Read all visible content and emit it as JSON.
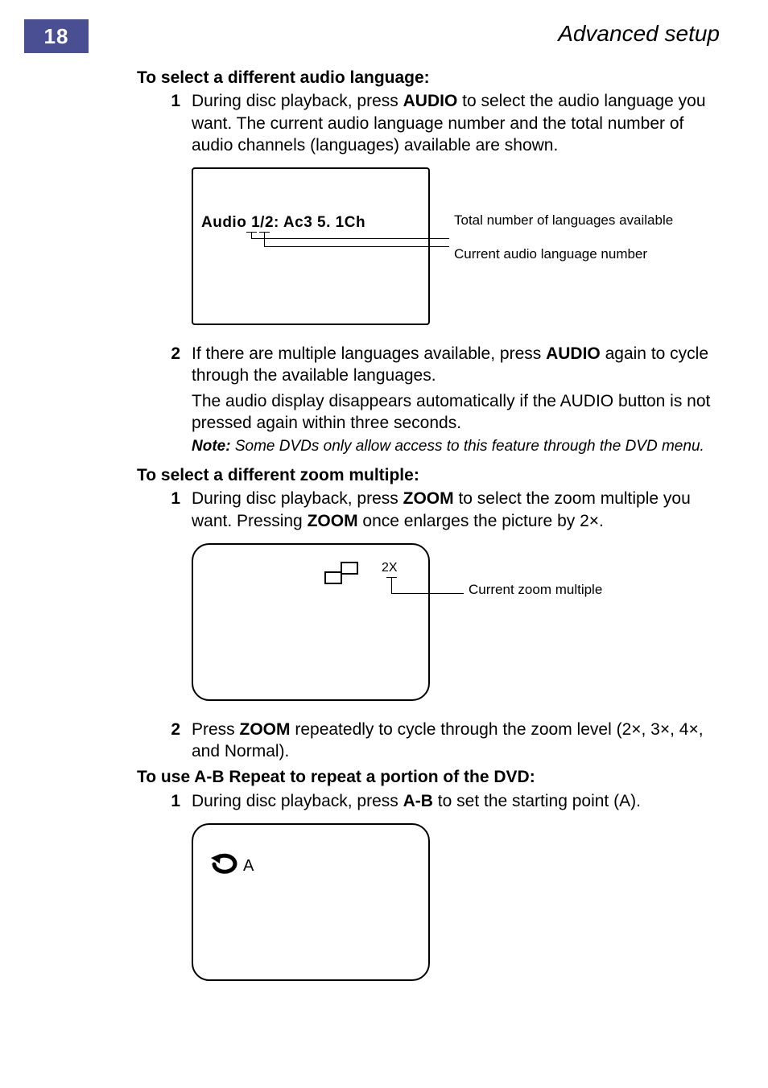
{
  "header": {
    "page_number": "18",
    "title": "Advanced setup"
  },
  "sect_audio": {
    "heading": "To select a different audio language:",
    "step1_pre": "During disc playback, press ",
    "step1_btn": "AUDIO",
    "step1_post": " to select the audio language you want. The current audio language number and the total number of audio channels (languages) available are shown.",
    "fig_text": "Audio 1/2: Ac3 5. 1Ch",
    "callout_total": "Total number of languages available",
    "callout_current": "Current audio language number",
    "step2_pre": "If there are multiple languages available, press ",
    "step2_btn": "AUDIO",
    "step2_post": " again to cycle through the available languages.",
    "step2_para_pre": "The audio display disappears automatically if the ",
    "step2_para_btn": "AUDIO",
    "step2_para_post": " button is not pressed again within three seconds.",
    "note_label": "Note:",
    "note_text": " Some DVDs only allow access to this feature through the DVD menu."
  },
  "sect_zoom": {
    "heading": "To select a different zoom multiple:",
    "step1_pre": "During disc playback, press ",
    "step1_btn1": "ZOOM",
    "step1_mid": " to select the zoom multiple you want. Pressing ",
    "step1_btn2": "ZOOM",
    "step1_post": " once enlarges the picture by 2×.",
    "fig_label": "2X",
    "callout": "Current zoom multiple",
    "step2_pre": "Press ",
    "step2_btn": "ZOOM",
    "step2_post": " repeatedly to cycle through the zoom level (2×, 3×, 4×, and Normal)."
  },
  "sect_ab": {
    "heading": "To use A-B Repeat to repeat a portion of the DVD:",
    "step1_pre": "During disc playback, press ",
    "step1_btn": "A-B",
    "step1_post": " to set the starting point (A).",
    "fig_letter": "A"
  }
}
